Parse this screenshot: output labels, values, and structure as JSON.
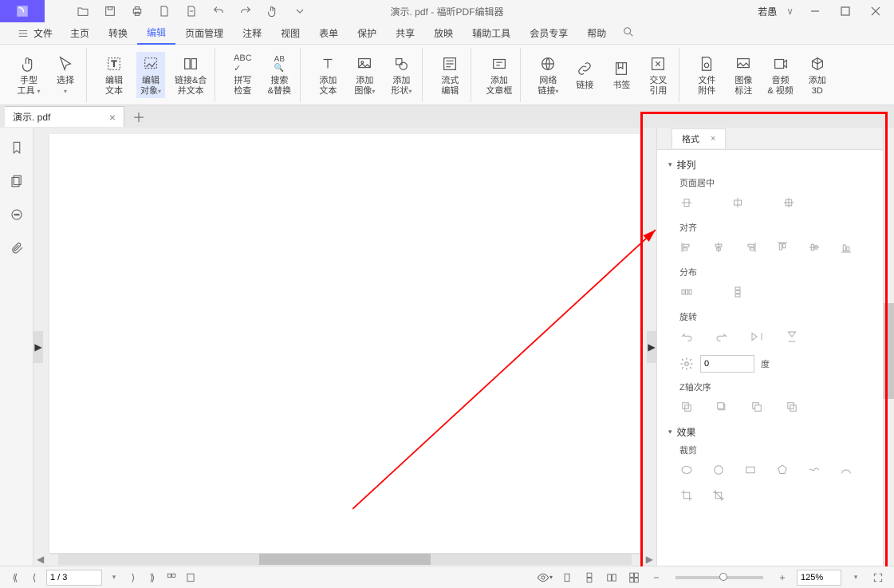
{
  "title": {
    "filename": "演示. pdf",
    "appname": "福昕PDF编辑器",
    "separator": " - "
  },
  "user_label": "若愚",
  "menu": {
    "file": "文件",
    "items": [
      "主页",
      "转换",
      "编辑",
      "页面管理",
      "注释",
      "视图",
      "表单",
      "保护",
      "共享",
      "放映",
      "辅助工具",
      "会员专享",
      "帮助"
    ],
    "active_index": 2
  },
  "ribbon": {
    "hand": "手型\n工具",
    "select": "选择",
    "edit_text": "编辑\n文本",
    "edit_obj": "编辑\n对象",
    "link_merge": "链接&合\n并文本",
    "spell": "拼写\n检查",
    "search_replace": "搜索\n&替换",
    "add_text": "添加\n文本",
    "add_image": "添加\n图像",
    "add_shape": "添加\n形状",
    "reflow": "流式\n编辑",
    "textbox": "添加\n文章框",
    "weblink": "网络\n链接",
    "link": "链接",
    "bookmark": "书签",
    "crossref": "交叉\n引用",
    "attachment": "文件\n附件",
    "image_annot": "图像\n标注",
    "audio_video": "音频\n& 视频",
    "add_3d": "添加\n3D"
  },
  "tabs": {
    "doc_tab": "演示. pdf"
  },
  "format_panel": {
    "tab": "格式",
    "arrange": "排列",
    "page_center": "页面居中",
    "align": "对齐",
    "distribute": "分布",
    "rotate": "旋转",
    "rotate_value": "0",
    "degree": "度",
    "z_order": "Z轴次序",
    "effects": "效果",
    "crop": "裁剪"
  },
  "status": {
    "page": "1 / 3",
    "zoom": "125%"
  }
}
